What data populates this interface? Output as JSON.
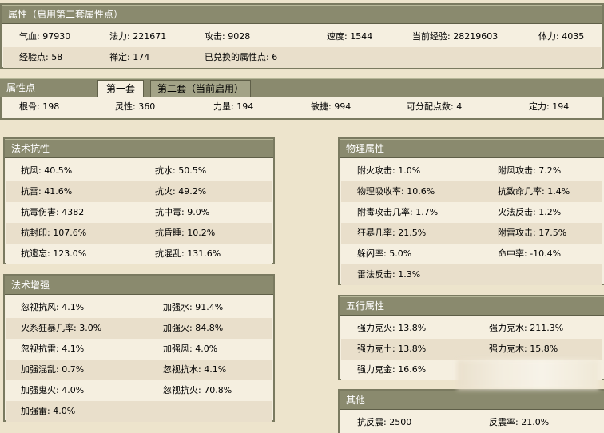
{
  "attr_panel": {
    "title": "属性（启用第二套属性点）",
    "row1": [
      "气血: 97930",
      "法力: 221671",
      "攻击: 9028",
      "速度: 1544",
      "当前经验: 28219603",
      "体力: 4035"
    ],
    "row2": [
      "经验点: 58",
      "禅定: 174",
      "已兑换的属性点: 6"
    ]
  },
  "points_panel": {
    "title": "属性点",
    "tabs": [
      "第一套",
      "第二套（当前启用）"
    ],
    "row": [
      "根骨: 198",
      "灵性: 360",
      "力量: 194",
      "敏捷: 994",
      "可分配点数: 4",
      "定力: 194"
    ]
  },
  "magic_resist": {
    "title": "法术抗性",
    "rows": [
      [
        "抗风: 40.5%",
        "抗水: 50.5%"
      ],
      [
        "抗雷: 41.6%",
        "抗火: 49.2%"
      ],
      [
        "抗毒伤害: 4382",
        "抗中毒: 9.0%"
      ],
      [
        "抗封印: 107.6%",
        "抗昏睡: 10.2%"
      ],
      [
        "抗遗忘: 123.0%",
        "抗混乱: 131.6%"
      ]
    ]
  },
  "magic_boost": {
    "title": "法术增强",
    "rows": [
      [
        "忽视抗风: 4.1%",
        "加强水: 91.4%"
      ],
      [
        "火系狂暴几率: 3.0%",
        "加强火: 84.8%"
      ],
      [
        "忽视抗雷: 4.1%",
        "加强风: 4.0%"
      ],
      [
        "加强混乱: 0.7%",
        "忽视抗水: 4.1%"
      ],
      [
        "加强鬼火: 4.0%",
        "忽视抗火: 70.8%"
      ],
      [
        "加强雷: 4.0%",
        ""
      ]
    ]
  },
  "physical": {
    "title": "物理属性",
    "rows": [
      [
        "附火攻击: 1.0%",
        "附风攻击: 7.2%"
      ],
      [
        "物理吸收率: 10.6%",
        "抗致命几率: 1.4%"
      ],
      [
        "附毒攻击几率: 1.7%",
        "火法反击: 1.2%"
      ],
      [
        "狂暴几率: 21.5%",
        "附雷攻击: 17.5%"
      ],
      [
        "躲闪率: 5.0%",
        "命中率: -10.4%"
      ],
      [
        "雷法反击: 1.3%",
        ""
      ]
    ]
  },
  "five_elements": {
    "title": "五行属性",
    "rows": [
      [
        "强力克火: 13.8%",
        "强力克水: 211.3%"
      ],
      [
        "强力克土: 13.8%",
        "强力克木: 15.8%"
      ],
      [
        "强力克金: 16.6%",
        ""
      ]
    ]
  },
  "other": {
    "title": "其他",
    "rows": [
      [
        "抗反震: 2500",
        "反震率: 21.0%"
      ]
    ]
  }
}
